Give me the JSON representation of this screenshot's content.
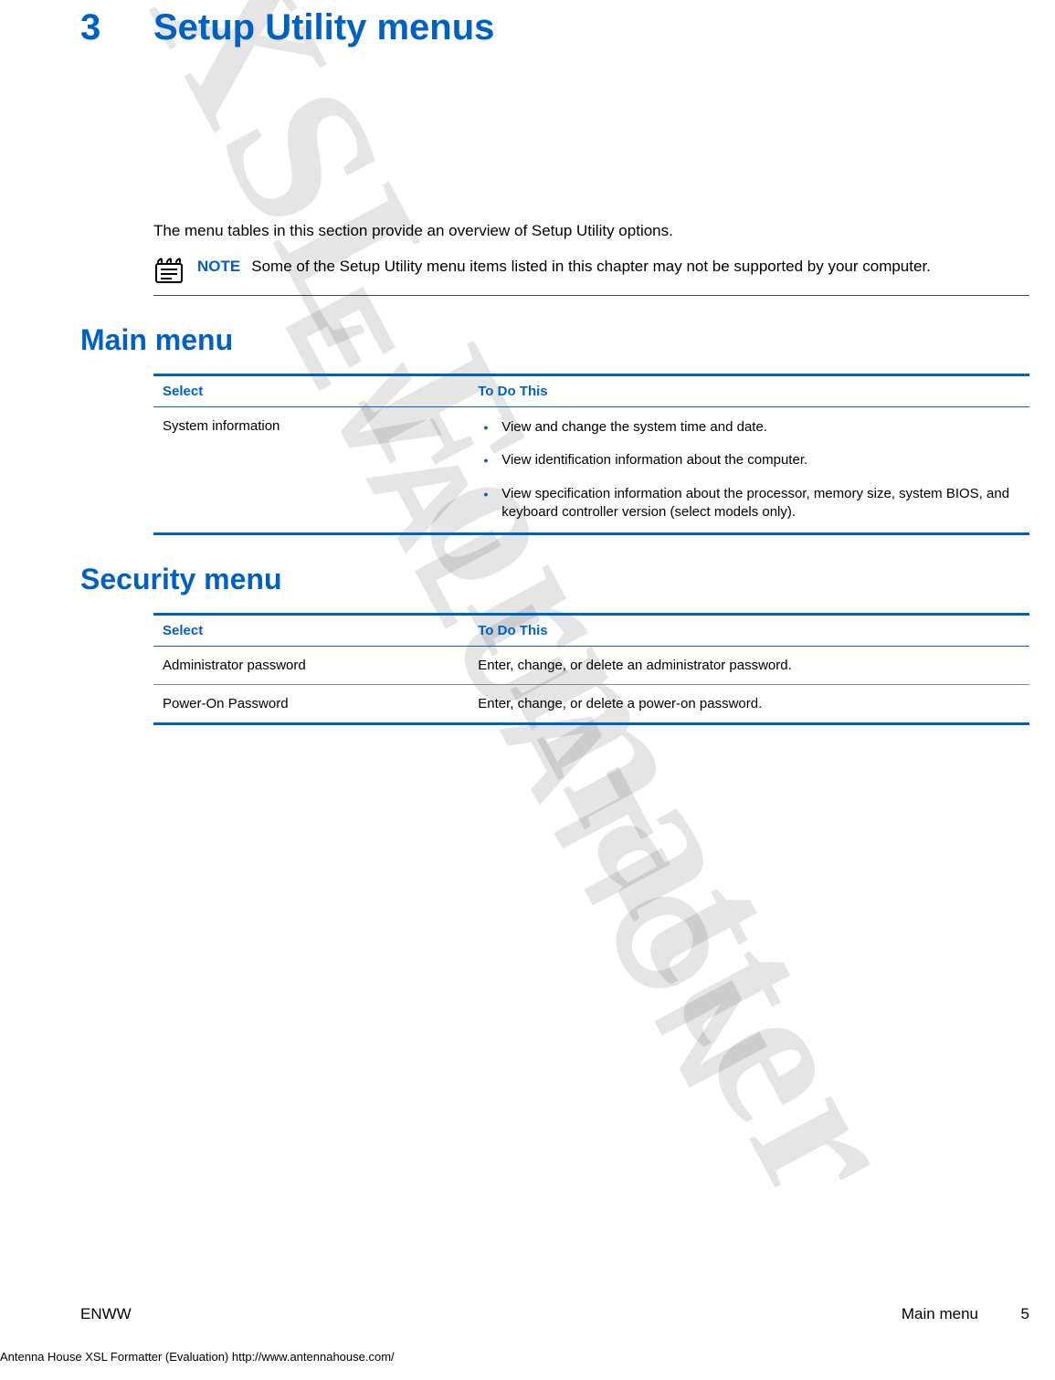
{
  "watermark": {
    "line1": "XSL Formatter",
    "line2": "EVALUATION"
  },
  "chapter": {
    "number": "3",
    "title": "Setup Utility menus"
  },
  "intro": "The menu tables in this section provide an overview of Setup Utility options.",
  "note": {
    "label": "NOTE",
    "text": "Some of the Setup Utility menu items listed in this chapter may not be supported by your computer."
  },
  "sections": {
    "main": {
      "heading": "Main menu",
      "table": {
        "headers": [
          "Select",
          "To Do This"
        ],
        "rows": [
          {
            "select": "System information",
            "todo_list": [
              "View and change the system time and date.",
              "View identification information about the computer.",
              "View specification information about the processor, memory size, system BIOS, and keyboard controller version (select models only)."
            ]
          }
        ]
      }
    },
    "security": {
      "heading": "Security menu",
      "table": {
        "headers": [
          "Select",
          "To Do This"
        ],
        "rows": [
          {
            "select": "Administrator password",
            "todo": "Enter, change, or delete an administrator password."
          },
          {
            "select": "Power-On Password",
            "todo": "Enter, change, or delete a power-on password."
          }
        ]
      }
    }
  },
  "footer": {
    "left": "ENWW",
    "right_label": "Main menu",
    "page": "5"
  },
  "eval_footer": "Antenna House XSL Formatter (Evaluation)  http://www.antennahouse.com/"
}
